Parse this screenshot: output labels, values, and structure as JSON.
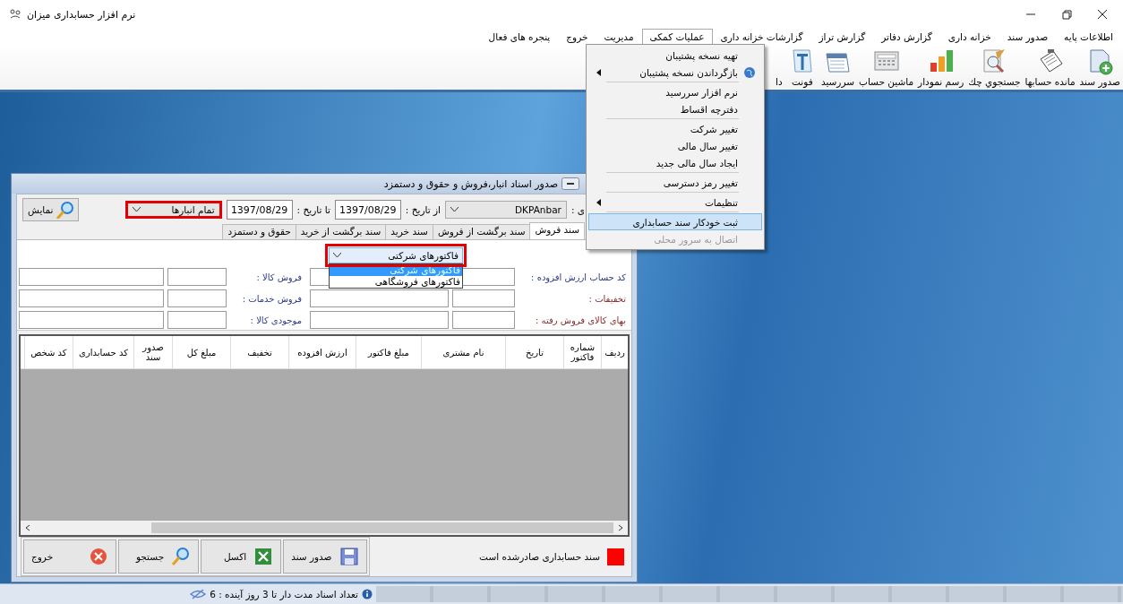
{
  "window": {
    "title": "نرم افزار حسابداری میزان"
  },
  "menu_bar": [
    {
      "label": "اطلاعات پایه",
      "selected": false
    },
    {
      "label": "صدور سند",
      "selected": false
    },
    {
      "label": "خزانه داری",
      "selected": false
    },
    {
      "label": "گزارش دفاتر",
      "selected": false
    },
    {
      "label": "گزارش تراز",
      "selected": false
    },
    {
      "label": "گزارشات خزانه داری",
      "selected": false
    },
    {
      "label": "عملیات کمکی",
      "selected": true
    },
    {
      "label": "مدیریت",
      "selected": false
    },
    {
      "label": "خروج",
      "selected": false
    },
    {
      "label": "پنجره های فعال",
      "selected": false
    }
  ],
  "toolbar": [
    {
      "label": "صدور سند",
      "kind": "document-add"
    },
    {
      "label": "مانده حسابها",
      "kind": "notepad"
    },
    {
      "label": "جستجوي چك",
      "kind": "document-search"
    },
    {
      "label": "رسم نمودار",
      "kind": "chart"
    },
    {
      "label": "ماشین حساب",
      "kind": "calculator"
    },
    {
      "label": "سررسید",
      "kind": "calendar"
    },
    {
      "label": "فونت",
      "kind": "font"
    },
    {
      "label": "دا",
      "kind": "covered"
    }
  ],
  "popup_menu": {
    "groups": [
      [
        {
          "label": "تهیه نسخه پشتیبان",
          "kind": "plain",
          "submenu": false,
          "selected": false,
          "disabled": false
        },
        {
          "label": "بازگرداندن نسخه پشتیبان",
          "kind": "globe",
          "submenu": true,
          "selected": false,
          "disabled": false
        }
      ],
      [
        {
          "label": "نرم افزار سررسید",
          "kind": "plain",
          "submenu": false,
          "selected": false,
          "disabled": false
        },
        {
          "label": "دفترچه اقساط",
          "kind": "plain",
          "submenu": false,
          "selected": false,
          "disabled": false
        }
      ],
      [
        {
          "label": "تغییر شرکت",
          "kind": "plain",
          "submenu": false,
          "selected": false,
          "disabled": false
        },
        {
          "label": "تغییر سال مالی",
          "kind": "plain",
          "submenu": false,
          "selected": false,
          "disabled": false
        },
        {
          "label": "ایجاد سال مالی جدید",
          "kind": "plain",
          "submenu": false,
          "selected": false,
          "disabled": false
        }
      ],
      [
        {
          "label": "تغییر رمز دسترسی",
          "kind": "plain",
          "submenu": false,
          "selected": false,
          "disabled": false
        }
      ],
      [
        {
          "label": "تنظیمات",
          "kind": "plain",
          "submenu": true,
          "selected": false,
          "disabled": false
        }
      ],
      [
        {
          "label": "ثبت خودکار سند حسابداری",
          "kind": "plain",
          "submenu": false,
          "selected": true,
          "disabled": false
        },
        {
          "label": "اتصال به سرور محلی",
          "kind": "plain",
          "submenu": false,
          "selected": false,
          "disabled": true
        }
      ]
    ]
  },
  "dialog": {
    "title": "صدور اسناد انبار،فروش و حقوق و دستمزد",
    "filter": {
      "warehouse_label": "ی :",
      "warehouse": "DKPAnbar",
      "from_label": "از تاریخ :",
      "from_date": "1397/08/29",
      "to_label": "تا تاریخ :",
      "to_date": "1397/08/29",
      "store_select": {
        "value": "تمام انبارها",
        "highlighted": true
      },
      "show_button": "نمایش"
    },
    "tabs": [
      {
        "label": "سند فروش",
        "selected": true
      },
      {
        "label": "سند برگشت از فروش",
        "selected": false
      },
      {
        "label": "سند خرید",
        "selected": false
      },
      {
        "label": "سند برگشت از خرید",
        "selected": false
      },
      {
        "label": "حقوق و دستمزد",
        "selected": false
      }
    ],
    "invoice_type": {
      "value": "فاکتورهای شرکتی",
      "highlighted": true,
      "options": [
        {
          "label": "فاکتورهای شرکتی",
          "selected": true
        },
        {
          "label": "فاکتورهای فروشگاهی",
          "selected": false
        }
      ]
    },
    "account_fields": [
      {
        "label": "کد حساب ارزش افزوده :",
        "color": "#2b3a8c"
      },
      {
        "label": "تخفیفات :",
        "color": "#8b2a2a"
      },
      {
        "label": "بهای کالای فروش رفته :",
        "color": "#8b2a2a"
      }
    ],
    "sales_fields": [
      {
        "label": "فروش کالا :",
        "color": "#2b3a8c"
      },
      {
        "label": "فروش خدمات :",
        "color": "#2b3a8c"
      },
      {
        "label": "موجودی کالا :",
        "color": "#2b3a8c"
      }
    ],
    "table": {
      "columns": [
        "ردیف",
        "شماره فاکتور",
        "تاریخ",
        "نام مشتری",
        "مبلغ فاکتور",
        "ارزش افزوده",
        "تخفیف",
        "مبلغ کل",
        "صدور سند",
        "کد حسابداری",
        "کد شخص"
      ]
    },
    "legend": {
      "color": "#ff0000",
      "text": "سند حسابداری صادرشده است"
    },
    "buttons": [
      {
        "label": "صدور سند",
        "kind": "save"
      },
      {
        "label": "اکسل",
        "kind": "excel"
      },
      {
        "label": "جستجو",
        "kind": "search"
      },
      {
        "label": "خروج",
        "kind": "exit"
      }
    ]
  },
  "status_bar": {
    "notice": "تعداد اسناد مدت دار تا 3 روز آینده : 6"
  }
}
